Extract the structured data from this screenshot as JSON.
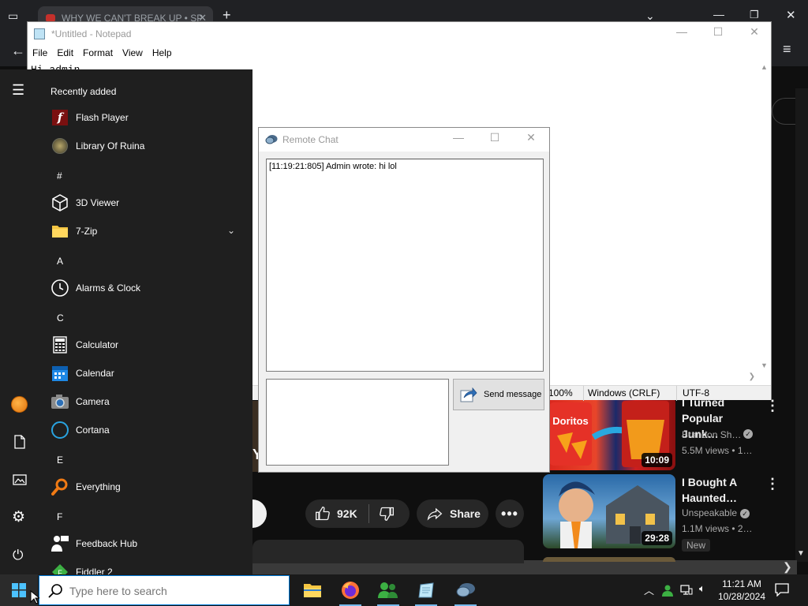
{
  "browser": {
    "tab_title": "WHY WE CAN'T BREAK UP • SP",
    "new_tab": "+",
    "tab_close": "✕"
  },
  "video": {
    "cut_text": "Y",
    "likes": "92K",
    "share": "Share"
  },
  "recommended": [
    {
      "title": "I Turned Popular Junk…",
      "channel": "Brandon Sh…",
      "views": "5.5M views • 1…",
      "duration": "10:09",
      "badge": ""
    },
    {
      "title": "I Bought A Haunted…",
      "channel": "Unspeakable",
      "views": "1.1M views • 2…",
      "duration": "29:28",
      "badge": "New"
    }
  ],
  "notepad": {
    "title": "*Untitled - Notepad",
    "menu": [
      "File",
      "Edit",
      "Format",
      "View",
      "Help"
    ],
    "content": "Hi admin",
    "status": {
      "zoom": "100%",
      "line_endings": "Windows (CRLF)",
      "encoding": "UTF-8"
    }
  },
  "chat": {
    "title": "Remote Chat",
    "log": "[11:19:21:805] Admin wrote: hi lol",
    "input_value": "",
    "send_label": "Send message"
  },
  "start_menu": {
    "recently_added": "Recently added",
    "items": [
      {
        "type": "app",
        "label": "Flash Player",
        "icon": "flash-icon"
      },
      {
        "type": "app",
        "label": "Library Of Ruina",
        "icon": "library-of-ruina-icon"
      },
      {
        "type": "letter",
        "label": "#"
      },
      {
        "type": "app",
        "label": "3D Viewer",
        "icon": "cube-icon"
      },
      {
        "type": "app",
        "label": "7-Zip",
        "icon": "folder-icon",
        "expandable": true
      },
      {
        "type": "letter",
        "label": "A"
      },
      {
        "type": "app",
        "label": "Alarms & Clock",
        "icon": "clock-icon"
      },
      {
        "type": "letter",
        "label": "C"
      },
      {
        "type": "app",
        "label": "Calculator",
        "icon": "calculator-icon"
      },
      {
        "type": "app",
        "label": "Calendar",
        "icon": "calendar-icon"
      },
      {
        "type": "app",
        "label": "Camera",
        "icon": "camera-icon"
      },
      {
        "type": "app",
        "label": "Cortana",
        "icon": "cortana-icon"
      },
      {
        "type": "letter",
        "label": "E"
      },
      {
        "type": "app",
        "label": "Everything",
        "icon": "search-icon"
      },
      {
        "type": "letter",
        "label": "F"
      },
      {
        "type": "app",
        "label": "Feedback Hub",
        "icon": "feedback-icon"
      },
      {
        "type": "app",
        "label": "Fiddler 2",
        "icon": "fiddler-icon"
      }
    ]
  },
  "taskbar": {
    "search_placeholder": "Type here to search",
    "time": "11:21 AM",
    "date": "10/28/2024"
  },
  "colors": {
    "start_bg": "#1f1f1f",
    "taskbar_bg": "#1a1a1a",
    "accent": "#0078d7",
    "youtube_bg": "#0f0f0f"
  }
}
